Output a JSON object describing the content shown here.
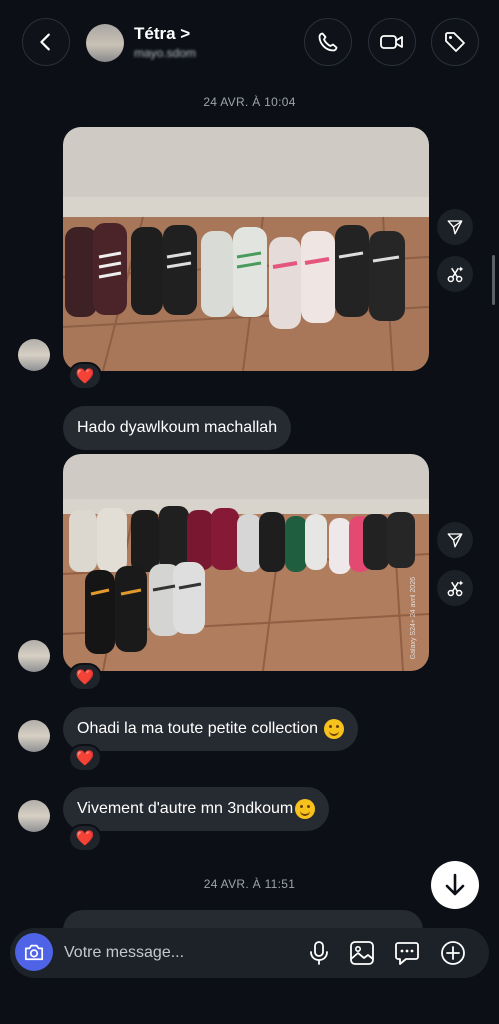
{
  "header": {
    "contact_name": "Tétra >",
    "contact_subtitle": "mayo.sdom",
    "icons": [
      "back-arrow-icon",
      "phone-icon",
      "video-camera-icon",
      "tag-icon"
    ]
  },
  "conversation": {
    "timestamp_1": "24 AVR. À 10:04",
    "photo_1": {
      "reaction": "❤️",
      "side_actions": [
        "share-icon",
        "ai-edit-icon"
      ]
    },
    "message_1": "Hado dyawlkoum machallah",
    "photo_2": {
      "reaction": "❤️",
      "watermark": "Galaxy S24+ 24 avril 2026",
      "side_actions": [
        "share-icon",
        "ai-edit-icon"
      ]
    },
    "message_2": {
      "text": "Ohadi la ma toute petite collection",
      "emoji": "🫠",
      "reaction": "❤️"
    },
    "message_3": {
      "text": "Vivement d'autre mn 3ndkoum",
      "emoji": "😊",
      "reaction": "❤️"
    },
    "timestamp_2": "24 AVR. À 11:51",
    "partial_message": "..."
  },
  "composer": {
    "placeholder": "Votre message...",
    "icons": [
      "camera-icon",
      "microphone-icon",
      "gallery-icon",
      "sticker-icon",
      "plus-icon"
    ]
  },
  "colors": {
    "background": "#0c1016",
    "bubble": "#262a31",
    "accent": "#4e63e6",
    "heart": "#f0283c"
  }
}
